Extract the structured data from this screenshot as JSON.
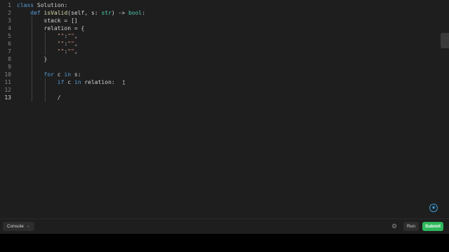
{
  "editor": {
    "line_numbers": [
      "1",
      "2",
      "3",
      "4",
      "5",
      "6",
      "7",
      "8",
      "9",
      "10",
      "11",
      "12",
      "13"
    ],
    "active_line": "13",
    "lines": [
      [
        {
          "t": "class",
          "c": "kw"
        },
        {
          "t": " Solution:",
          "c": ""
        }
      ],
      [
        {
          "t": "    ",
          "c": ""
        },
        {
          "t": "def",
          "c": "kw"
        },
        {
          "t": " ",
          "c": ""
        },
        {
          "t": "isValid",
          "c": "fn"
        },
        {
          "t": "(self, s: ",
          "c": ""
        },
        {
          "t": "str",
          "c": "ty"
        },
        {
          "t": ") -> ",
          "c": ""
        },
        {
          "t": "bool",
          "c": "ty"
        },
        {
          "t": ":",
          "c": ""
        }
      ],
      [
        {
          "t": "        stack = []",
          "c": ""
        }
      ],
      [
        {
          "t": "        relation = {",
          "c": ""
        }
      ],
      [
        {
          "t": "            ",
          "c": ""
        },
        {
          "t": "\"\"",
          "c": "str"
        },
        {
          "t": ":",
          "c": ""
        },
        {
          "t": "\"\"",
          "c": "str"
        },
        {
          "t": ",",
          "c": ""
        }
      ],
      [
        {
          "t": "            ",
          "c": ""
        },
        {
          "t": "\"\"",
          "c": "str"
        },
        {
          "t": ":",
          "c": ""
        },
        {
          "t": "\"\"",
          "c": "str"
        },
        {
          "t": ",",
          "c": ""
        }
      ],
      [
        {
          "t": "            ",
          "c": ""
        },
        {
          "t": "\"\"",
          "c": "str"
        },
        {
          "t": ":",
          "c": ""
        },
        {
          "t": "\"\"",
          "c": "str"
        },
        {
          "t": ",",
          "c": ""
        }
      ],
      [
        {
          "t": "        }",
          "c": ""
        }
      ],
      [
        {
          "t": "",
          "c": ""
        }
      ],
      [
        {
          "t": "        ",
          "c": ""
        },
        {
          "t": "for",
          "c": "kw"
        },
        {
          "t": " c ",
          "c": ""
        },
        {
          "t": "in",
          "c": "kw"
        },
        {
          "t": " s:",
          "c": ""
        }
      ],
      [
        {
          "t": "            ",
          "c": ""
        },
        {
          "t": "if",
          "c": "kw"
        },
        {
          "t": " c ",
          "c": ""
        },
        {
          "t": "in",
          "c": "kw"
        },
        {
          "t": " relation:",
          "c": ""
        }
      ],
      [
        {
          "t": "",
          "c": ""
        }
      ],
      [
        {
          "t": "            /",
          "c": ""
        }
      ]
    ]
  },
  "toolbar": {
    "console_label": "Console",
    "run_label": "Run",
    "submit_label": "Submit"
  },
  "colors": {
    "background": "#1e1e1e",
    "keyword": "#569cd6",
    "string": "#ce9178",
    "submit": "#2eb85c"
  }
}
